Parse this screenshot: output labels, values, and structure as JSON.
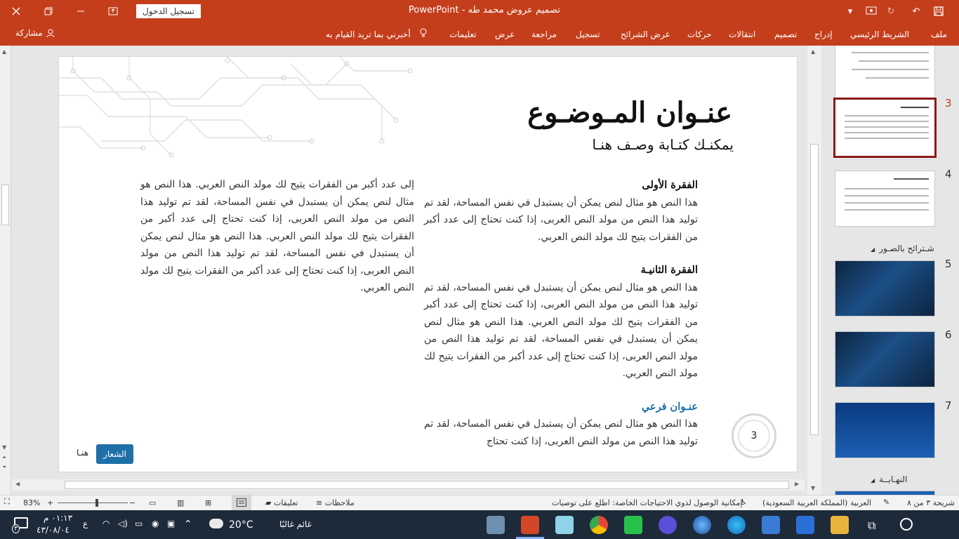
{
  "titlebar": {
    "app_name": "PowerPoint",
    "separator": "-",
    "user": "محمد طه",
    "file_name": "تصميم عروض",
    "signin_label": "تسجيل الدخول"
  },
  "ribbon": {
    "tabs": [
      "ملف",
      "الشريط الرئيسي",
      "إدراج",
      "تصميم",
      "انتقالات",
      "حركات",
      "عرض الشرائح",
      "تسجيل",
      "مراجعة",
      "عرض",
      "تعليمات"
    ],
    "tell_me": "أخبرني بما تريد القيام به",
    "share_label": "مشاركة"
  },
  "slide": {
    "title": "عنـوان المـوضـوع",
    "subtitle": "يمكنـك كتـابة وصـف هنـا",
    "right_column": {
      "heading1": "الفقرة الأولى",
      "para1": "هذا النص هو مثال لنص يمكن أن يستبدل في نفس المساحة، لقد تم توليد هذا النص من مولد النص العربى، إذا كنت تحتاج إلى عدد أكبر من الفقرات يتيح لك مولد النص العربي.",
      "heading2": "الفقرة الثانيـة",
      "para2": "هذا النص هو مثال لنص يمكن أن يستبدل في نفس المساحة، لقد تم توليد هذا النص من مولد النص العربى، إذا كنت تحتاج إلى عدد أكبر من الفقرات يتيح لك مولد النص العربي. هذا النص هو مثال لنص يمكن أن يستبدل في نفس المساحة، لقد تم توليد هذا النص من مولد النص العربى، إذا كنت تحتاج إلى عدد أكبر من الفقرات يتيح لك مولد النص العربي.",
      "heading3": "عنـوان فرعي",
      "para3": "هذا النص هو مثال لنص يمكن أن يستبدل في نفس المساحة، لقد تم توليد هذا النص من مولد النص العربى، إذا كنت تحتاج"
    },
    "left_column": {
      "para": "إلى عدد أكبر من الفقرات يتيح لك مولد النص العربي. هذا النص هو مثال لنص يمكن أن يستبدل في نفس المساحة، لقد تم توليد هذا النص من مولد النص العربى، إذا كنت تحتاج إلى عدد أكبر من الفقرات يتيح لك مولد النص العربي. هذا النص هو مثال لنص يمكن أن يستبدل في نفس المساحة، لقد تم توليد هذا النص من مولد النص العربى، إذا كنت تحتاج إلى عدد أكبر من الفقرات يتيح لك مولد النص العربي."
    },
    "page_number": "3",
    "logo_label": "الشعار",
    "logo_text": "هنـا"
  },
  "thumbnails": {
    "numbers": [
      "3",
      "4",
      "5",
      "6",
      "7"
    ],
    "section_photos": "شـترائح بالصـور",
    "section_end": "النهـايــة"
  },
  "status": {
    "slide_info": "شريحة ٣ من ٨",
    "language": "العربية (المملكة العربية السعودية)",
    "accessibility": "إمكانية الوصول لذوي الاحتياجات الخاصة: اطلع على توصيات",
    "notes": "ملاحظات",
    "comments": "تعليقات",
    "zoom": "83%"
  },
  "taskbar": {
    "weather_temp": "20°C",
    "weather_text": "غائم غالبًا",
    "time": "٠١:١٣ م",
    "date": "٤٣/٠٨/٠٤",
    "lang_indicator": "ع",
    "notif_count": "٣"
  },
  "colors": {
    "accent": "#c43e1c",
    "selected_thumb": "#8b1a1a",
    "blue": "#1f6fa8"
  }
}
